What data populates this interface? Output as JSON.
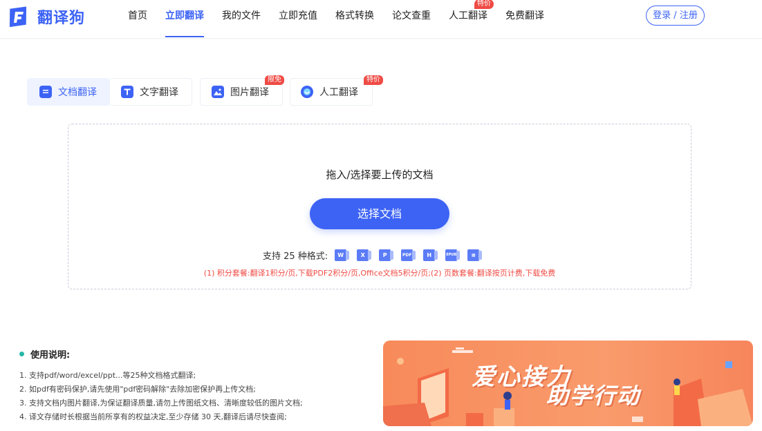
{
  "header": {
    "logo_text": "翻译狗",
    "nav": [
      {
        "label": "首页"
      },
      {
        "label": "立即翻译",
        "active": true
      },
      {
        "label": "我的文件"
      },
      {
        "label": "立即充值"
      },
      {
        "label": "格式转换"
      },
      {
        "label": "论文查重"
      },
      {
        "label": "人工翻译",
        "badge": "特价"
      },
      {
        "label": "免费翻译"
      }
    ],
    "login_label": "登录 / 注册"
  },
  "tabs": [
    {
      "label": "文档翻译",
      "icon": "document-icon",
      "active": true
    },
    {
      "label": "文字翻译",
      "icon": "text-icon"
    },
    {
      "label": "图片翻译",
      "icon": "image-icon",
      "badge": "限免"
    },
    {
      "label": "人工翻译",
      "icon": "human-icon",
      "badge": "特价"
    }
  ],
  "upload": {
    "title": "拖入/选择要上传的文档",
    "button_label": "选择文档",
    "formats_label": "支持 25 种格式:",
    "format_icons": [
      "word-icon",
      "excel-icon",
      "ppt-icon",
      "pdf-icon",
      "html-icon",
      "epub-icon",
      "table-icon"
    ],
    "pricing": "(1) 积分套餐:翻译1积分/页,下载PDF2积分/页,Office文档5积分/页;(2) 页数套餐:翻译按页计费,下载免费"
  },
  "instructions": {
    "title": "使用说明:",
    "items": [
      "1. 支持pdf/word/excel/ppt...等25种文档格式翻译;",
      "2. 如pdf有密码保护,请先使用\"pdf密码解除\"去除加密保护再上传文档;",
      "3. 支持文档内图片翻译,为保证翻译质量,请勿上传图纸文档、清晰度较低的图片文档;",
      "4. 译文存储时长根据当前所享有的权益决定,至少存储 30 天,翻译后请尽快查阅;"
    ]
  },
  "banner": {
    "line1": "爱心接力",
    "line2": "助学行动"
  },
  "colors": {
    "accent": "#3d63f5",
    "badge": "#ef4b45",
    "banner": "#f88a5a",
    "pricing_text": "#ef4b45",
    "dot": "#26b6a8"
  }
}
